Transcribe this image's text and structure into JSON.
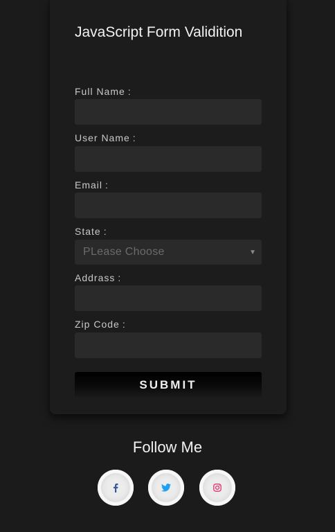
{
  "form": {
    "title": "JavaScript Form Validition",
    "fields": {
      "full_name": {
        "label": "Full Name",
        "colon": ":",
        "value": "",
        "placeholder": ""
      },
      "user_name": {
        "label": "User Name",
        "colon": ":",
        "value": "",
        "placeholder": ""
      },
      "email": {
        "label": "Email",
        "colon": ":",
        "value": "",
        "placeholder": ""
      },
      "state": {
        "label": "State",
        "colon": ":",
        "selected": "PLease Choose"
      },
      "address": {
        "label": "Addrass",
        "colon": ":",
        "value": "",
        "placeholder": ""
      },
      "zip_code": {
        "label": "Zip Code",
        "colon": ":",
        "value": "",
        "placeholder": ""
      }
    },
    "submit_label": "SUBMIT"
  },
  "follow": {
    "title": "Follow Me",
    "social": [
      {
        "icon": "facebook-icon",
        "color": "#3b5998"
      },
      {
        "icon": "twitter-icon",
        "color": "#1da1f2"
      },
      {
        "icon": "instagram-icon",
        "color": "#e1306c"
      }
    ]
  },
  "colors": {
    "background": "#1b1b1b",
    "card": "#1c1c1c",
    "input": "#2a2a2a"
  }
}
